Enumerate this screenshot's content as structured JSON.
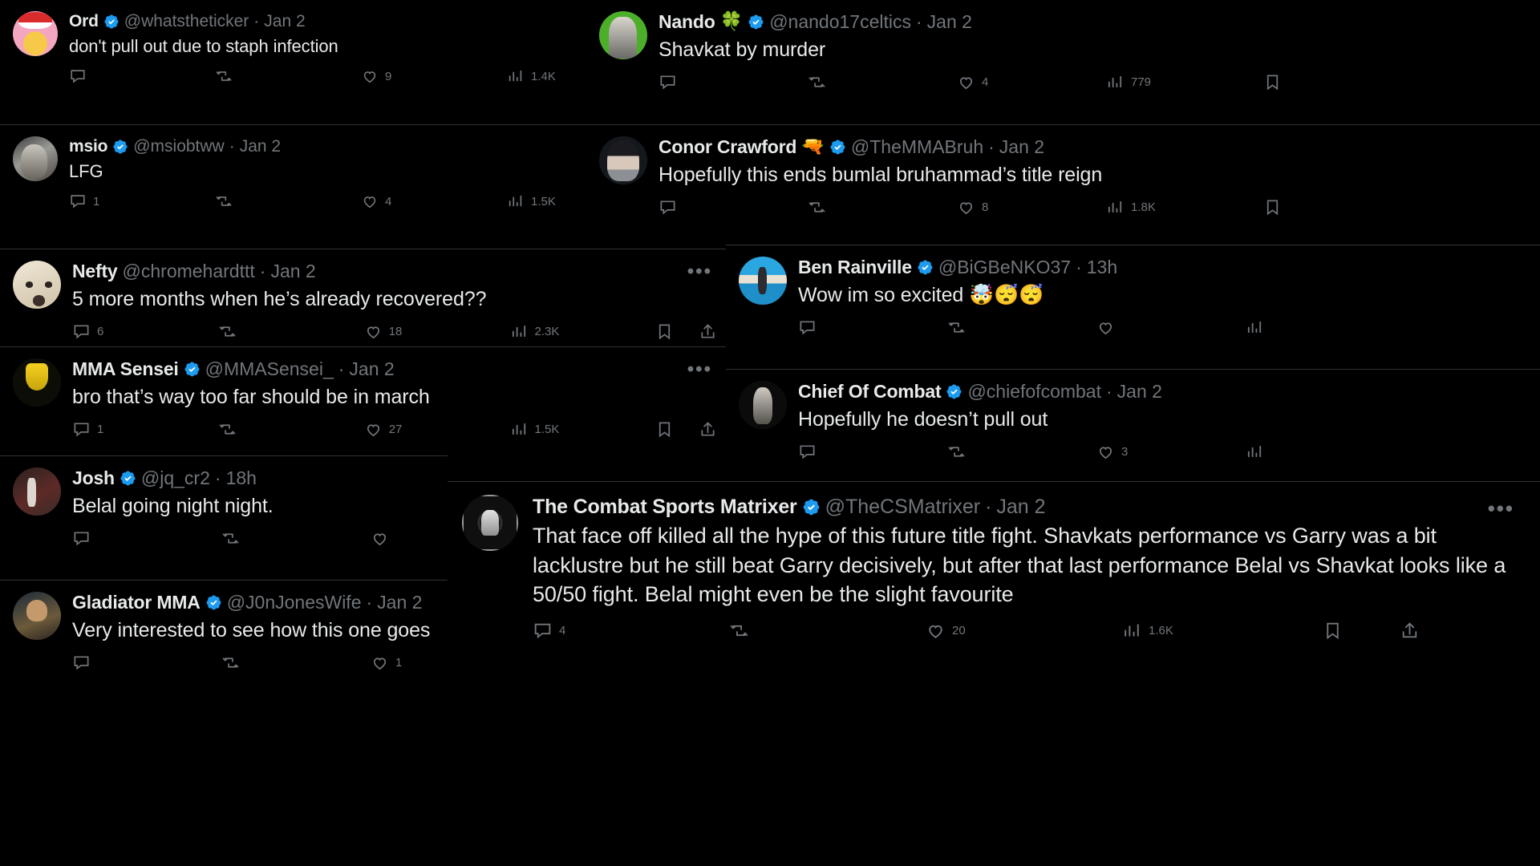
{
  "app": {
    "theme": "dark",
    "background": "#000000",
    "accent": "#1d9bf0",
    "muted_text": "#71767b",
    "text": "#e7e9ea",
    "divider": "#2f3336"
  },
  "icons": {
    "reply": "reply-icon",
    "retweet": "retweet-icon",
    "like": "like-icon",
    "views": "views-icon",
    "bookmark": "bookmark-icon",
    "share": "share-icon",
    "more": "more-options-icon",
    "verified": "verified-badge-icon"
  },
  "tweets": [
    {
      "id": "ord",
      "display_name": "Ord",
      "name_emoji": "",
      "verified": true,
      "handle": "@whatstheticker",
      "separator": "·",
      "timestamp": "Jan 2",
      "text": "don't pull out due to staph infection",
      "avatar": "av-ord",
      "has_more": false,
      "stats": {
        "replies": "",
        "retweets": "",
        "likes": "9",
        "views": "1.4K"
      },
      "show_bookmark": false,
      "show_share": false
    },
    {
      "id": "msio",
      "display_name": "msio",
      "name_emoji": "",
      "verified": true,
      "handle": "@msiobtww",
      "separator": "·",
      "timestamp": "Jan 2",
      "text": "LFG",
      "avatar": "av-msio",
      "has_more": false,
      "stats": {
        "replies": "1",
        "retweets": "",
        "likes": "4",
        "views": "1.5K"
      },
      "show_bookmark": false,
      "show_share": false
    },
    {
      "id": "nefty",
      "display_name": "Nefty",
      "name_emoji": "",
      "verified": false,
      "handle": "@chromehardttt",
      "separator": "·",
      "timestamp": "Jan 2",
      "text": "5 more months when he’s already recovered??",
      "avatar": "av-nefty",
      "has_more": true,
      "stats": {
        "replies": "6",
        "retweets": "",
        "likes": "18",
        "views": "2.3K"
      },
      "show_bookmark": true,
      "show_share": true
    },
    {
      "id": "sensei",
      "display_name": "MMA Sensei",
      "name_emoji": "",
      "verified": true,
      "handle": "@MMASensei_",
      "separator": "·",
      "timestamp": "Jan 2",
      "text": "bro that’s way too far should be in march",
      "avatar": "av-sensei",
      "has_more": true,
      "stats": {
        "replies": "1",
        "retweets": "",
        "likes": "27",
        "views": "1.5K"
      },
      "show_bookmark": true,
      "show_share": true
    },
    {
      "id": "josh",
      "display_name": "Josh",
      "name_emoji": "",
      "verified": true,
      "handle": "@jq_cr2",
      "separator": "·",
      "timestamp": "18h",
      "text": "Belal going night night.",
      "avatar": "av-josh",
      "has_more": false,
      "stats": {
        "replies": "",
        "retweets": "",
        "likes": "",
        "views": ""
      },
      "show_bookmark": false,
      "show_share": false
    },
    {
      "id": "glad",
      "display_name": "Gladiator MMA",
      "name_emoji": "",
      "verified": true,
      "handle": "@J0nJonesWife",
      "separator": "·",
      "timestamp": "Jan 2",
      "text": "Very interested to see how this one goes",
      "avatar": "av-glad",
      "has_more": false,
      "stats": {
        "replies": "",
        "retweets": "",
        "likes": "1",
        "views": ""
      },
      "show_bookmark": false,
      "show_share": false
    },
    {
      "id": "nando",
      "display_name": "Nando",
      "name_emoji": "🍀",
      "verified": true,
      "handle": "@nando17celtics",
      "separator": "·",
      "timestamp": "Jan 2",
      "text": "Shavkat by murder",
      "avatar": "av-nando",
      "has_more": false,
      "stats": {
        "replies": "",
        "retweets": "",
        "likes": "4",
        "views": "779"
      },
      "show_bookmark": true,
      "show_share": false
    },
    {
      "id": "conor",
      "display_name": "Conor Crawford",
      "name_emoji": "🔫",
      "verified": true,
      "handle": "@TheMMABruh",
      "separator": "·",
      "timestamp": "Jan 2",
      "text": "Hopefully this ends bumlal bruhammad’s title reign",
      "avatar": "av-conor",
      "has_more": false,
      "stats": {
        "replies": "",
        "retweets": "",
        "likes": "8",
        "views": "1.8K"
      },
      "show_bookmark": true,
      "show_share": false
    },
    {
      "id": "ben",
      "display_name": "Ben Rainville",
      "name_emoji": "",
      "verified": true,
      "handle": "@BiGBeNKO37",
      "separator": "·",
      "timestamp": "13h",
      "text": "Wow im so excited 🤯😴😴",
      "avatar": "av-ben",
      "has_more": false,
      "stats": {
        "replies": "",
        "retweets": "",
        "likes": "",
        "views": ""
      },
      "show_bookmark": false,
      "show_share": false
    },
    {
      "id": "chief",
      "display_name": "Chief Of Combat",
      "name_emoji": "",
      "verified": true,
      "handle": "@chiefofcombat",
      "separator": "·",
      "timestamp": "Jan 2",
      "text": "Hopefully he doesn’t pull out",
      "avatar": "av-chief",
      "has_more": false,
      "stats": {
        "replies": "",
        "retweets": "",
        "likes": "3",
        "views": ""
      },
      "show_bookmark": false,
      "show_share": false
    },
    {
      "id": "matrix",
      "display_name": "The Combat Sports Matrixer",
      "name_emoji": "",
      "verified": true,
      "handle": "@TheCSMatrixer",
      "separator": "·",
      "timestamp": "Jan 2",
      "text": "That face off killed all the hype of this future title fight. Shavkats performance vs Garry was a bit lacklustre but he still beat Garry decisively, but after that last performance Belal vs Shavkat looks like a 50/50 fight. Belal might even be the slight favourite",
      "avatar": "av-matrix",
      "has_more": true,
      "stats": {
        "replies": "4",
        "retweets": "",
        "likes": "20",
        "views": "1.6K"
      },
      "show_bookmark": true,
      "show_share": true
    }
  ],
  "more_label": "•••"
}
